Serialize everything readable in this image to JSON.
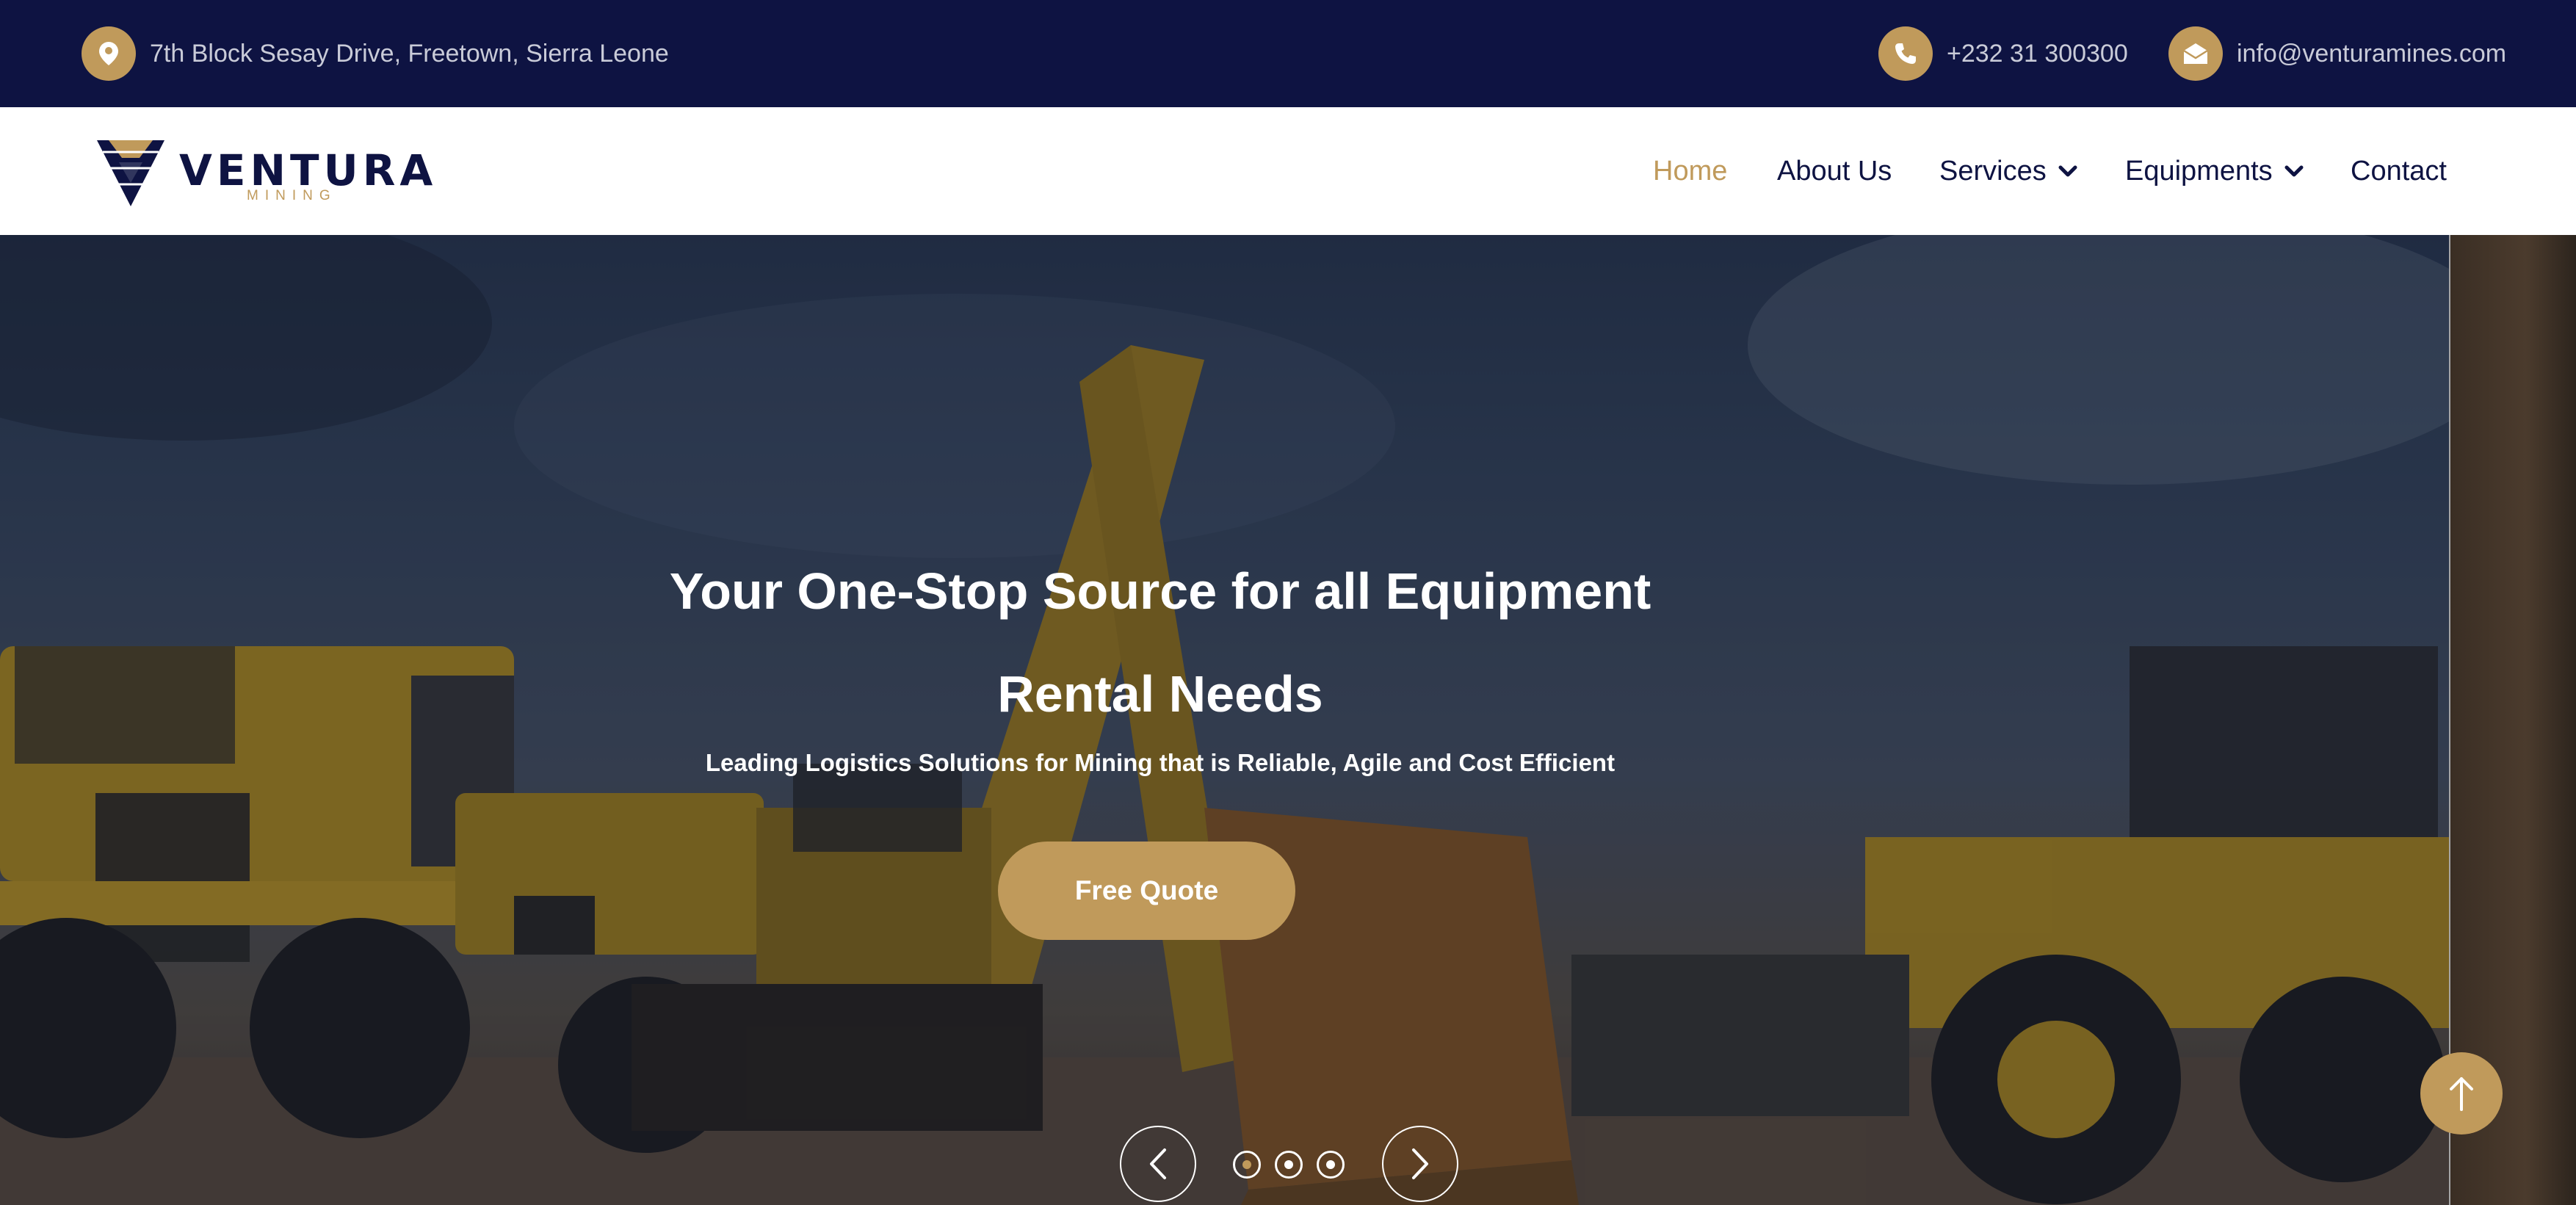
{
  "topbar": {
    "address": "7th Block Sesay Drive, Freetown, Sierra Leone",
    "phone": "+232 31 300300",
    "email": "info@venturamines.com",
    "icons": [
      "location-pin-icon",
      "phone-icon",
      "envelope-icon"
    ]
  },
  "logo": {
    "brand": "VENTURA",
    "subtitle": "MINING"
  },
  "nav": {
    "items": [
      {
        "label": "Home",
        "active": true
      },
      {
        "label": "About Us"
      },
      {
        "label": "Services",
        "dropdown": true
      },
      {
        "label": "Equipments",
        "dropdown": true
      },
      {
        "label": "Contact"
      }
    ]
  },
  "hero": {
    "title": "Your One-Stop Source for all Equipment Rental Needs",
    "subtitle": "Leading Logistics Solutions for Mining that is Reliable, Agile and Cost Efficient",
    "cta_label": "Free Quote",
    "slide_count": 3,
    "active_slide": 1
  },
  "colors": {
    "navy": "#0e1342",
    "gold": "#c09a5b",
    "white": "#ffffff"
  }
}
